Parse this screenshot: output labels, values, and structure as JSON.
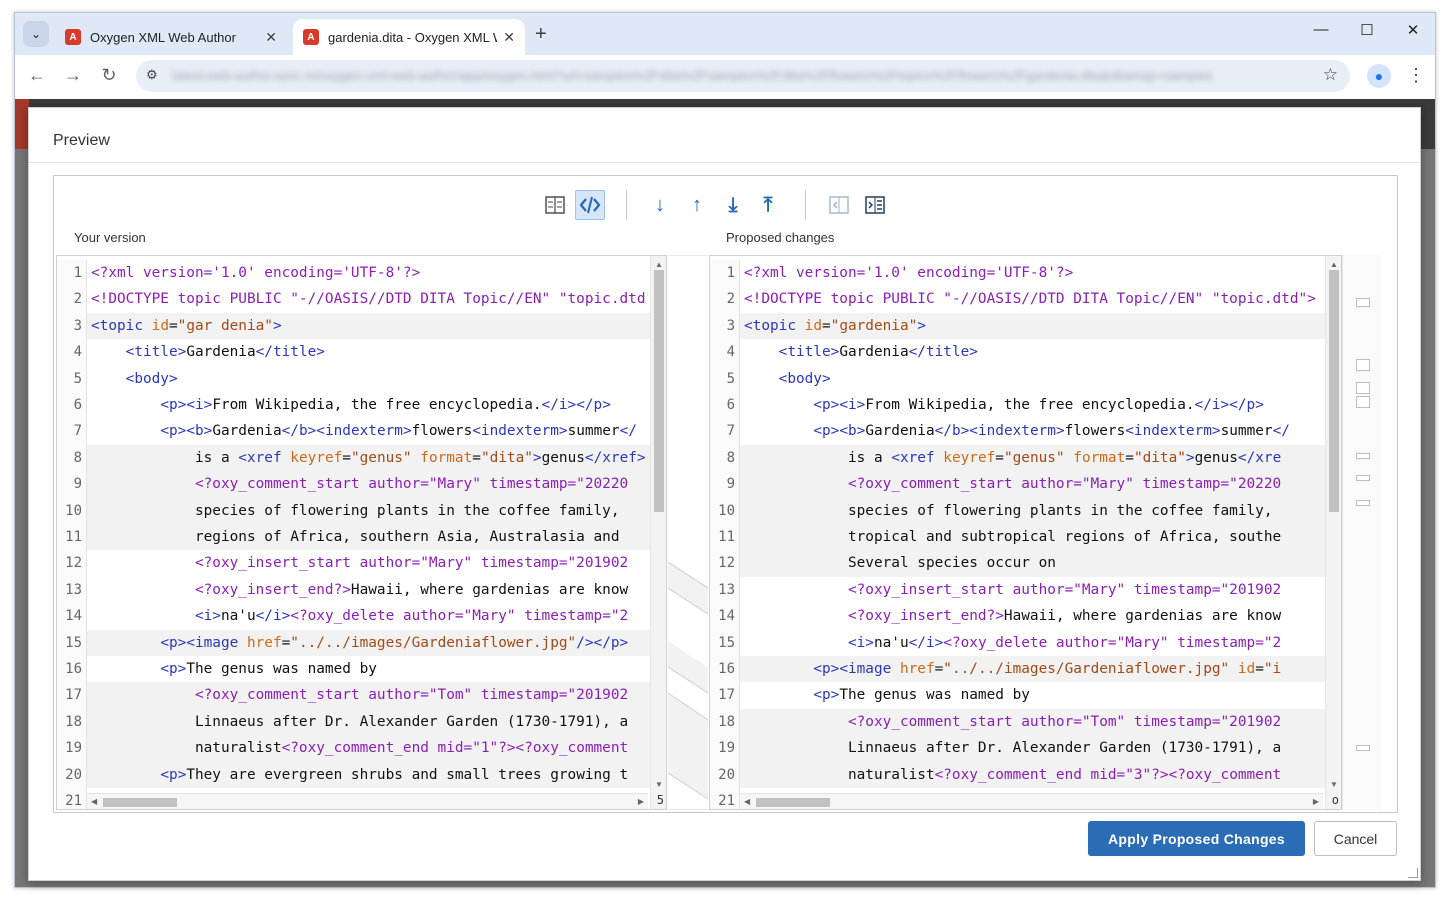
{
  "browser": {
    "tabs": [
      {
        "title": "Oxygen XML Web Author",
        "favicon": "oxygen-logo-icon"
      },
      {
        "title": "gardenia.dita - Oxygen XML Web Author",
        "favicon": "oxygen-logo-icon"
      }
    ],
    "favicon_text": "A",
    "tab_menu_glyph": "⌄",
    "close_glyph": "✕",
    "new_tab_glyph": "+",
    "window_controls": {
      "minimize": "—",
      "maximize": "☐",
      "close": "✕"
    },
    "nav": {
      "back": "←",
      "forward": "→",
      "reload": "↻"
    },
    "url": "latest.web-author.sync.ro/oxygen-xml-web-author/app/oxygen.html?url=samples%2Fdita%2Fsamples%2Fdita%2Fflowers%2Ftopics%2Fflowers%2Fgardenia.dita&ditamap=samples",
    "site_info_glyph": "⚙",
    "bookmark_glyph": "☆",
    "profile_glyph": "●",
    "menu_glyph": "⋮"
  },
  "dialog": {
    "title": "Preview",
    "left_label": "Your version",
    "right_label": "Proposed changes",
    "apply_label": "Apply Proposed Changes",
    "cancel_label": "Cancel",
    "toolbar": {
      "diff_view_icon": "diff-table-icon",
      "xml_view_icon": "xml-source-icon",
      "next_change": "↓",
      "prev_change": "↑",
      "last_change": "⤓",
      "first_change": "⤒",
      "copy_left_icon": "copy-left-icon",
      "copy_all_icon": "copy-all-icon"
    },
    "left_lines": [
      {
        "n": "1",
        "text": "<?xml version='1.0' encoding='UTF-8'?>"
      },
      {
        "n": "2",
        "text": "<!DOCTYPE topic PUBLIC \"-//OASIS//DTD DITA Topic//EN\" \"topic.dtd\">"
      },
      {
        "n": "3",
        "text": "<topic id=\"gar denia\">"
      },
      {
        "n": "4",
        "text": "    <title>Gardenia</title>"
      },
      {
        "n": "5",
        "text": "    <body>"
      },
      {
        "n": "6",
        "text": "        <p><i>From Wikipedia, the free encyclopedia.</i></p>"
      },
      {
        "n": "7",
        "text": "        <p><b>Gardenia</b><indexterm>flowers<indexterm>summer</"
      },
      {
        "n": "8",
        "text": "            is a <xref keyref=\"genus\" format=\"dita\">genus</xref>"
      },
      {
        "n": "9",
        "text": "            <?oxy_comment_start author=\"Mary\" timestamp=\"20220"
      },
      {
        "n": "10",
        "text": "            species of flowering plants in the coffee family,"
      },
      {
        "n": "11",
        "text": "            regions of Africa, southern Asia, Australasia and"
      },
      {
        "n": "12",
        "text": "            <?oxy_insert_start author=\"Mary\" timestamp=\"201902"
      },
      {
        "n": "13",
        "text": "            <?oxy_insert_end?>Hawaii, where gardenias are know"
      },
      {
        "n": "14",
        "text": "            <i>na'u</i><?oxy_delete author=\"Mary\" timestamp=\"2"
      },
      {
        "n": "15",
        "text": "        <p><image href=\"../../images/Gardeniaflower.jpg\"/></p>"
      },
      {
        "n": "16",
        "text": "        <p>The genus was named by"
      },
      {
        "n": "17",
        "text": "            <?oxy_comment_start author=\"Tom\" timestamp=\"201902"
      },
      {
        "n": "18",
        "text": "            Linnaeus after Dr. Alexander Garden (1730-1791), a"
      },
      {
        "n": "19",
        "text": "            naturalist<?oxy_comment_end mid=\"1\"?><?oxy_comment"
      },
      {
        "n": "20",
        "text": "        <p>They are evergreen shrubs and small trees growing t"
      },
      {
        "n": "21",
        "text": ""
      }
    ],
    "right_lines": [
      {
        "n": "1",
        "text": "<?xml version='1.0' encoding='UTF-8'?>"
      },
      {
        "n": "2",
        "text": "<!DOCTYPE topic PUBLIC \"-//OASIS//DTD DITA Topic//EN\" \"topic.dtd\">"
      },
      {
        "n": "3",
        "text": "<topic id=\"gardenia\">"
      },
      {
        "n": "4",
        "text": "    <title>Gardenia</title>"
      },
      {
        "n": "5",
        "text": "    <body>"
      },
      {
        "n": "6",
        "text": "        <p><i>From Wikipedia, the free encyclopedia.</i></p>"
      },
      {
        "n": "7",
        "text": "        <p><b>Gardenia</b><indexterm>flowers<indexterm>summer</"
      },
      {
        "n": "8",
        "text": "            is a <xref keyref=\"genus\" format=\"dita\">genus</xre"
      },
      {
        "n": "9",
        "text": "            <?oxy_comment_start author=\"Mary\" timestamp=\"20220"
      },
      {
        "n": "10",
        "text": "            species of flowering plants in the coffee family,"
      },
      {
        "n": "11",
        "text": "            tropical and subtropical regions of Africa, southe"
      },
      {
        "n": "12",
        "text": "            Several species occur on"
      },
      {
        "n": "13",
        "text": "            <?oxy_insert_start author=\"Mary\" timestamp=\"201902"
      },
      {
        "n": "14",
        "text": "            <?oxy_insert_end?>Hawaii, where gardenias are know"
      },
      {
        "n": "15",
        "text": "            <i>na'u</i><?oxy_delete author=\"Mary\" timestamp=\"2"
      },
      {
        "n": "16",
        "text": "        <p><image href=\"../../images/Gardeniaflower.jpg\" id=\"i"
      },
      {
        "n": "17",
        "text": "        <p>The genus was named by"
      },
      {
        "n": "18",
        "text": "            <?oxy_comment_start author=\"Tom\" timestamp=\"201902"
      },
      {
        "n": "19",
        "text": "            Linnaeus after Dr. Alexander Garden (1730-1791), a"
      },
      {
        "n": "20",
        "text": "            naturalist<?oxy_comment_end mid=\"3\"?><?oxy_comment"
      },
      {
        "n": "21",
        "text": ""
      }
    ],
    "left_trailing_char": "5",
    "right_trailing_char": "o",
    "left_diff_lines": [
      3,
      8,
      9,
      10,
      11,
      15,
      17,
      18,
      19,
      20
    ],
    "right_diff_lines": [
      3,
      8,
      9,
      10,
      11,
      12,
      16,
      18,
      19,
      20
    ]
  },
  "colors": {
    "primary": "#2a6cb5",
    "pi": "#8b1fb5",
    "tag": "#2a38b8",
    "attr": "#cc6a1a",
    "value": "#a14a16",
    "diff_bg": "#f2f2f2"
  }
}
